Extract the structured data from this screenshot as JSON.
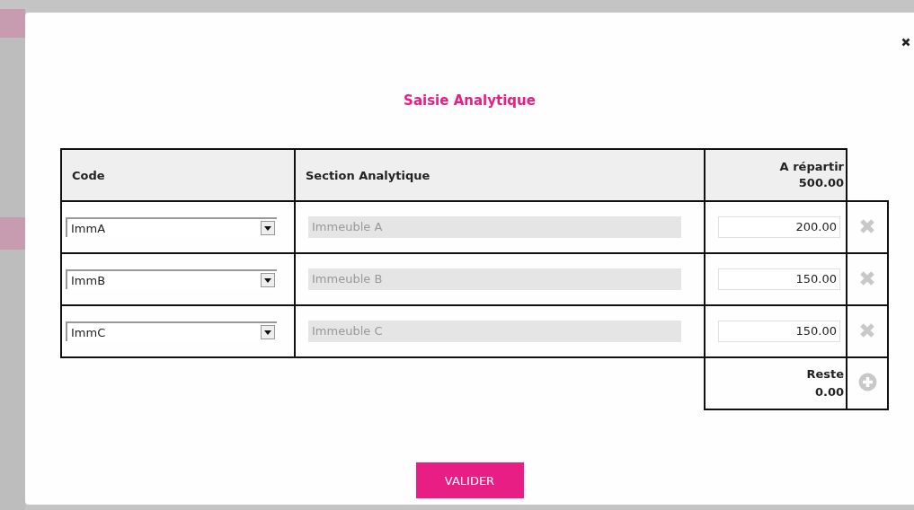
{
  "dialog": {
    "title": "Saisie Analytique",
    "table": {
      "columns": [
        {
          "label": "Code"
        },
        {
          "label": "Section Analytique"
        },
        {
          "label": "A répartir",
          "total": "500.00"
        }
      ],
      "rows": [
        {
          "code": "ImmA",
          "section": "Immeuble A",
          "section_disabled": true,
          "amount": "200.00"
        },
        {
          "code": "ImmB",
          "section": "Immeuble B",
          "section_disabled": true,
          "amount": "150.00"
        },
        {
          "code": "ImmC",
          "section": "Immeuble C",
          "section_disabled": true,
          "amount": "150.00"
        }
      ],
      "footer": {
        "label": "Reste",
        "value": "0.00"
      }
    },
    "buttons": [
      {
        "label": "VALIDER"
      }
    ]
  }
}
